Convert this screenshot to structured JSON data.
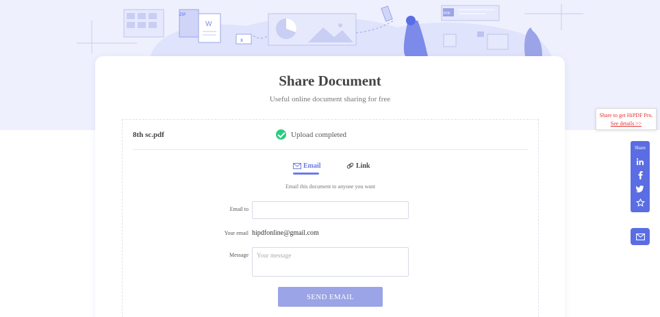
{
  "header": {
    "title": "Share Document",
    "subtitle": "Useful online document sharing for free"
  },
  "file": {
    "name": "8th sc.pdf",
    "status": "Upload completed"
  },
  "tabs": {
    "email_label": "Email",
    "link_label": "Link",
    "active": "Email"
  },
  "form": {
    "hint": "Email this document to anyone you want",
    "email_to_label": "Email to",
    "email_to_value": "",
    "your_email_label": "Your email",
    "your_email_value": "hipdfonline@gmail.com",
    "message_label": "Message",
    "message_placeholder": "Your message",
    "send_label": "SEND EMAIL"
  },
  "promo": {
    "text": "Share to get HiPDF Pro.",
    "link": "See details >>"
  },
  "share_bar": {
    "label": "Share",
    "icons": [
      "linkedin-icon",
      "facebook-icon",
      "twitter-icon",
      "star-icon"
    ]
  },
  "illustration": {
    "zip_badge": "ZIP",
    "word_badge": "W",
    "pdf_badge": "PDF"
  },
  "colors": {
    "accent": "#6a7be6",
    "share_bar": "#5b6de3",
    "send_button": "#9aa4e6",
    "success": "#2ccb7e",
    "promo_text": "#e53030",
    "hero_bg": "#eef0fd"
  }
}
